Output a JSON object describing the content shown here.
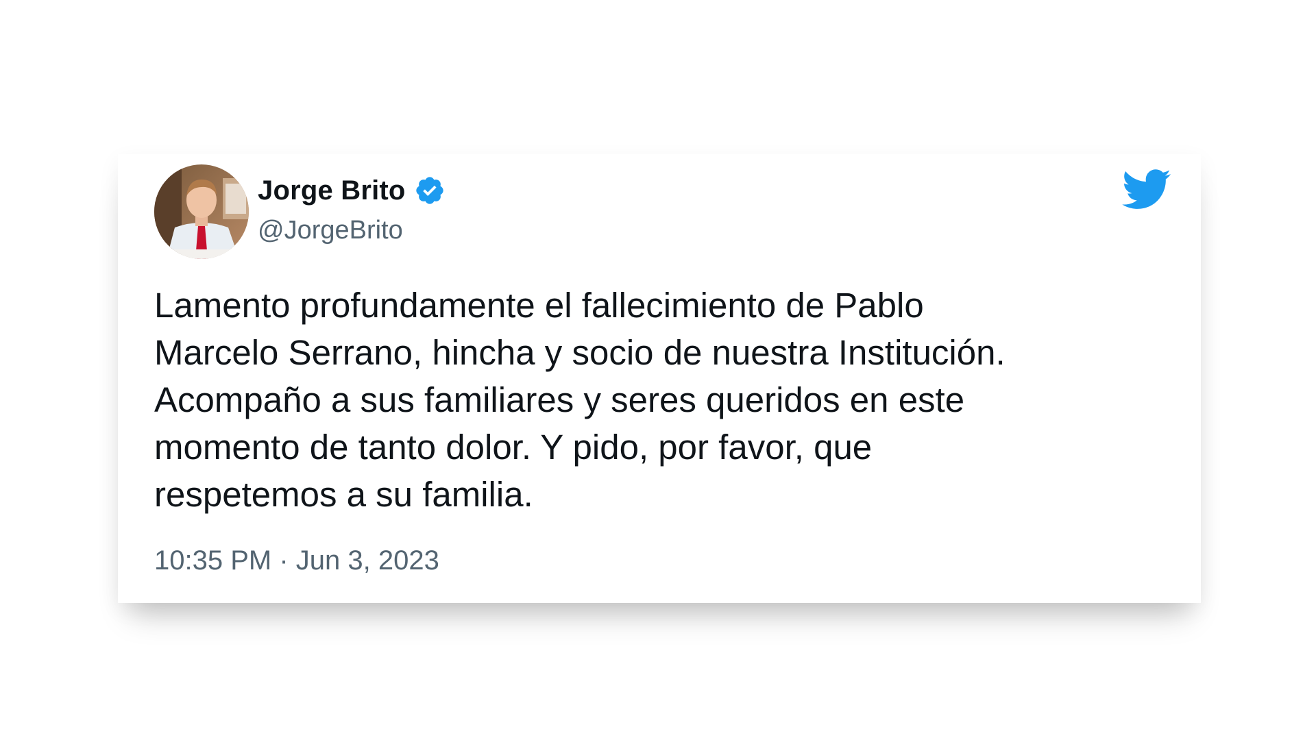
{
  "tweet": {
    "author": {
      "display_name": "Jorge Brito",
      "handle": "@JorgeBrito",
      "verified": true,
      "avatar_icon": "profile-photo"
    },
    "brand_icon": "twitter-bird-icon",
    "text": "Lamento profundamente el fallecimiento de Pablo\nMarcelo Serrano, hincha y socio de nuestra Institución.\nAcompaño a sus familiares y seres queridos en este\nmomento de tanto dolor. Y pido, por favor, que\nrespetemos a su familia.",
    "timestamp": "10:35 PM · Jun 3, 2023"
  },
  "colors": {
    "brand_blue": "#1d9bf0",
    "text_primary": "#0f1419",
    "text_secondary": "#536471",
    "tie_red": "#c8102e"
  }
}
